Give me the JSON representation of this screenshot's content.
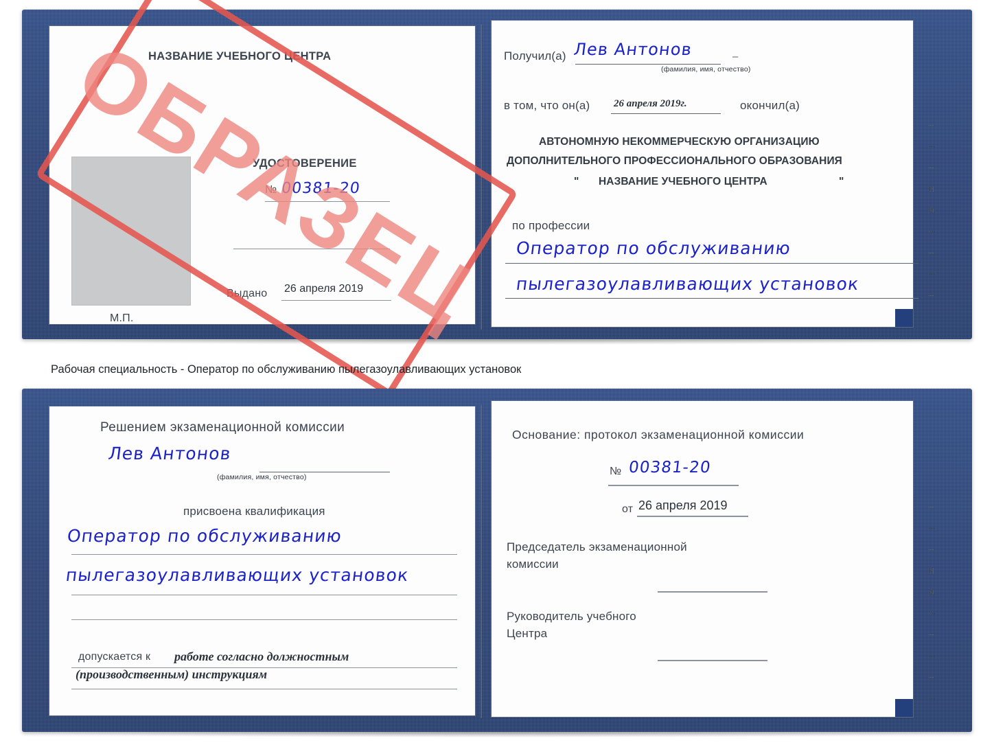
{
  "caption": "Рабочая специальность - Оператор по обслуживанию пылегазоулавливающих установок",
  "stamp": {
    "text": "ОБРАЗЕЦ",
    "color": "#e4574f"
  },
  "certificate_top": {
    "left_page": {
      "org_title": "НАЗВАНИЕ УЧЕБНОГО ЦЕНТРА",
      "doc_title": "УДОСТОВЕРЕНИЕ",
      "number_label": "№",
      "number_value": "00381-20",
      "issued_label": "Выдано",
      "issued_value": "26 апреля 2019",
      "seal_label": "М.П.",
      "photo_placeholder": "photo-placeholder"
    },
    "right_page": {
      "received_label": "Получил(а)",
      "received_value": "Лев Антонов",
      "fio_hint": "(фамилия, имя, отчество)",
      "in_that_label": "в том, что он(а)",
      "completion_date": "26 апреля 2019г.",
      "finished_label": "окончил(а)",
      "org_line_1": "АВТОНОМНУЮ НЕКОММЕРЧЕСКУЮ ОРГАНИЗАЦИЮ",
      "org_line_2": "ДОПОЛНИТЕЛЬНОГО ПРОФЕССИОНАЛЬНОГО ОБРАЗОВАНИЯ",
      "org_quote_open": "\"",
      "org_line_3": "НАЗВАНИЕ УЧЕБНОГО ЦЕНТРА",
      "org_quote_close": "\"",
      "profession_label": "по профессии",
      "profession_value_1": "Оператор по обслуживанию",
      "profession_value_2": "пылегазоулавливающих установок",
      "edge_fragments": [
        "–",
        "–",
        "–",
        "и",
        "а",
        "‹-",
        "–",
        "–",
        "–"
      ]
    }
  },
  "certificate_bottom": {
    "left_page": {
      "decision_label": "Решением экзаменационной комиссии",
      "name_value": "Лев Антонов",
      "fio_hint": "(фамилия, имя, отчество)",
      "qualification_label": "присвоена квалификация",
      "qualification_value_1": "Оператор по обслуживанию",
      "qualification_value_2": "пылегазоулавливающих установок",
      "allowed_label": "допускается к",
      "allowed_value_1": "работе согласно должностным",
      "allowed_value_2": "(производственным) инструкциям"
    },
    "right_page": {
      "basis_label": "Основание: протокол экзаменационной комиссии",
      "number_label": "№",
      "number_value": "00381-20",
      "date_label": "от",
      "date_value": "26 апреля 2019",
      "chairman_line_1": "Председатель экзаменационной",
      "chairman_line_2": "комиссии",
      "head_line_1": "Руководитель учебного",
      "head_line_2": "Центра",
      "edge_fragments": [
        "–",
        "–",
        "–",
        "и",
        "а",
        "‹-",
        "–",
        "–",
        "–",
        "–"
      ]
    }
  }
}
